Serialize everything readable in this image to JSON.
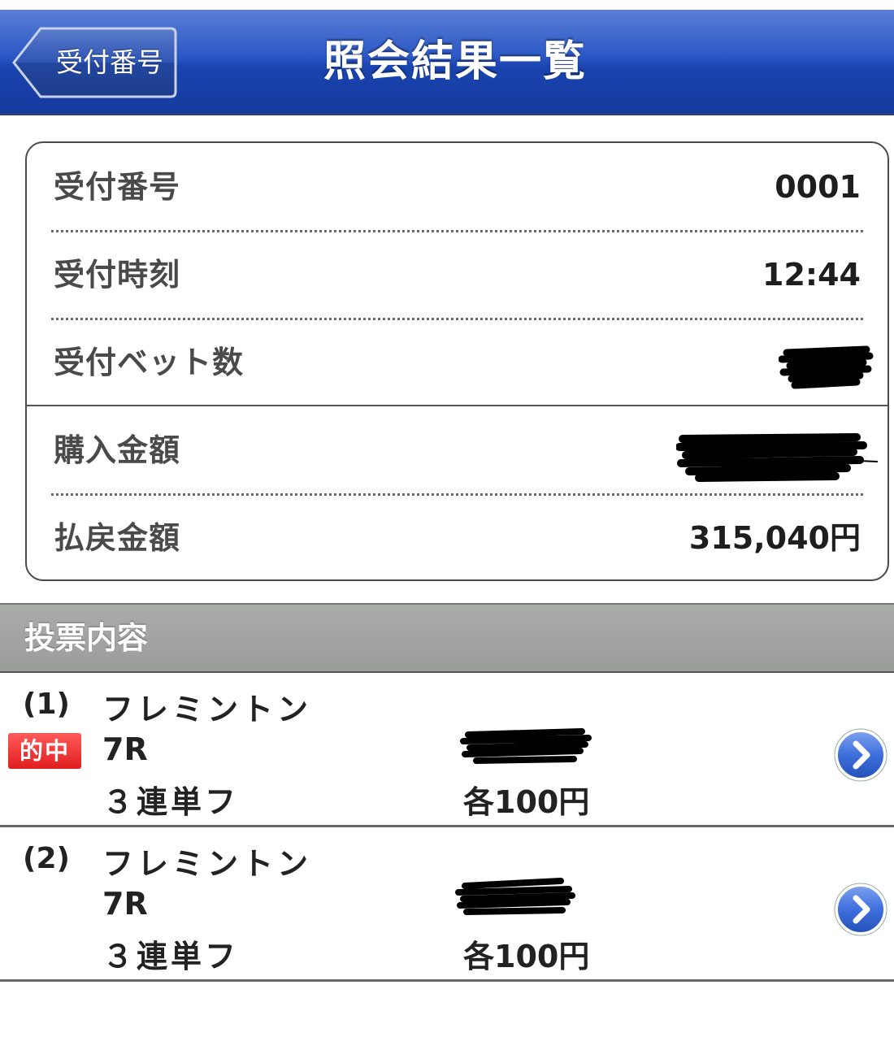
{
  "navbar": {
    "back_label": "受付番号",
    "title": "照会結果一覧"
  },
  "summary": {
    "receipt_number": {
      "label": "受付番号",
      "value": "0001"
    },
    "receipt_time": {
      "label": "受付時刻",
      "value": "12:44"
    },
    "bet_count": {
      "label": "受付ベット数",
      "value": ""
    },
    "purchase_amount": {
      "label": "購入金額",
      "value": ""
    },
    "payout_amount": {
      "label": "払戻金額",
      "value": "315,040円"
    }
  },
  "bets_section": {
    "title": "投票内容",
    "items": [
      {
        "index": "(1)",
        "venue": "フレミントン",
        "race": "7R",
        "kind": "３連単フ",
        "amount": "各100円",
        "badge": "的中"
      },
      {
        "index": "(2)",
        "venue": "フレミントン",
        "race": "7R",
        "kind": "３連単フ",
        "amount": "各100円",
        "badge": ""
      }
    ]
  },
  "colors": {
    "navbar_blue": "#1a44b0",
    "hit_badge_red": "#e01e1e",
    "section_gray": "#9a9d99",
    "chevron_blue": "#3e6fdc"
  },
  "icons": {
    "back": "back-arrow-icon",
    "detail": "chevron-right-icon"
  }
}
